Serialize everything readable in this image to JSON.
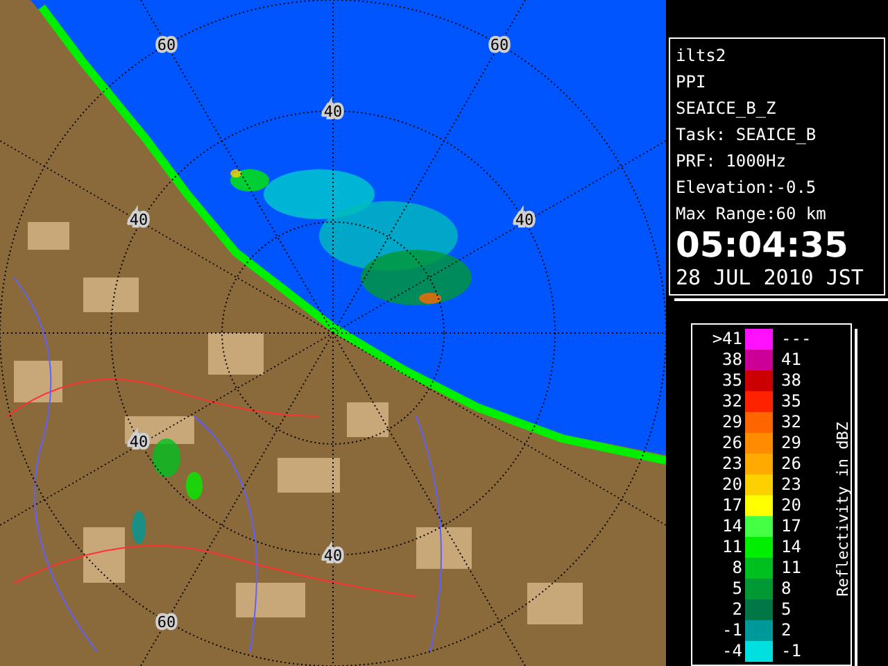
{
  "map": {
    "range_labels": [
      "60",
      "60",
      "40",
      "40",
      "40",
      "40",
      "40",
      "60"
    ]
  },
  "info": {
    "lines": [
      "ilts2",
      "PPI",
      "SEAICE_B_Z",
      "Task: SEAICE_B",
      "PRF: 1000Hz",
      "Elevation:-0.5",
      "Max Range:60 km"
    ],
    "time": "05:04:35",
    "date": "28 JUL 2010 JST"
  },
  "legend": {
    "title": "Reflectivity in dBZ",
    "rows": [
      {
        "low": ">41",
        "high": "---",
        "color": "#ff11ff"
      },
      {
        "low": "38",
        "high": "41",
        "color": "#cc0099"
      },
      {
        "low": "35",
        "high": "38",
        "color": "#cc0000"
      },
      {
        "low": "32",
        "high": "35",
        "color": "#ff2200"
      },
      {
        "low": "29",
        "high": "32",
        "color": "#ff6600"
      },
      {
        "low": "26",
        "high": "29",
        "color": "#ff8c00"
      },
      {
        "low": "23",
        "high": "26",
        "color": "#ffaa00"
      },
      {
        "low": "20",
        "high": "23",
        "color": "#ffd000"
      },
      {
        "low": "17",
        "high": "20",
        "color": "#ffff00"
      },
      {
        "low": "14",
        "high": "17",
        "color": "#44ff44"
      },
      {
        "low": "11",
        "high": "14",
        "color": "#00ee00"
      },
      {
        "low": "8",
        "high": "11",
        "color": "#00c020"
      },
      {
        "low": "5",
        "high": "8",
        "color": "#009933"
      },
      {
        "low": "2",
        "high": "5",
        "color": "#007744"
      },
      {
        "low": "-1",
        "high": "2",
        "color": "#009999"
      },
      {
        "low": "-4",
        "high": "-1",
        "color": "#00e0e0"
      }
    ]
  }
}
